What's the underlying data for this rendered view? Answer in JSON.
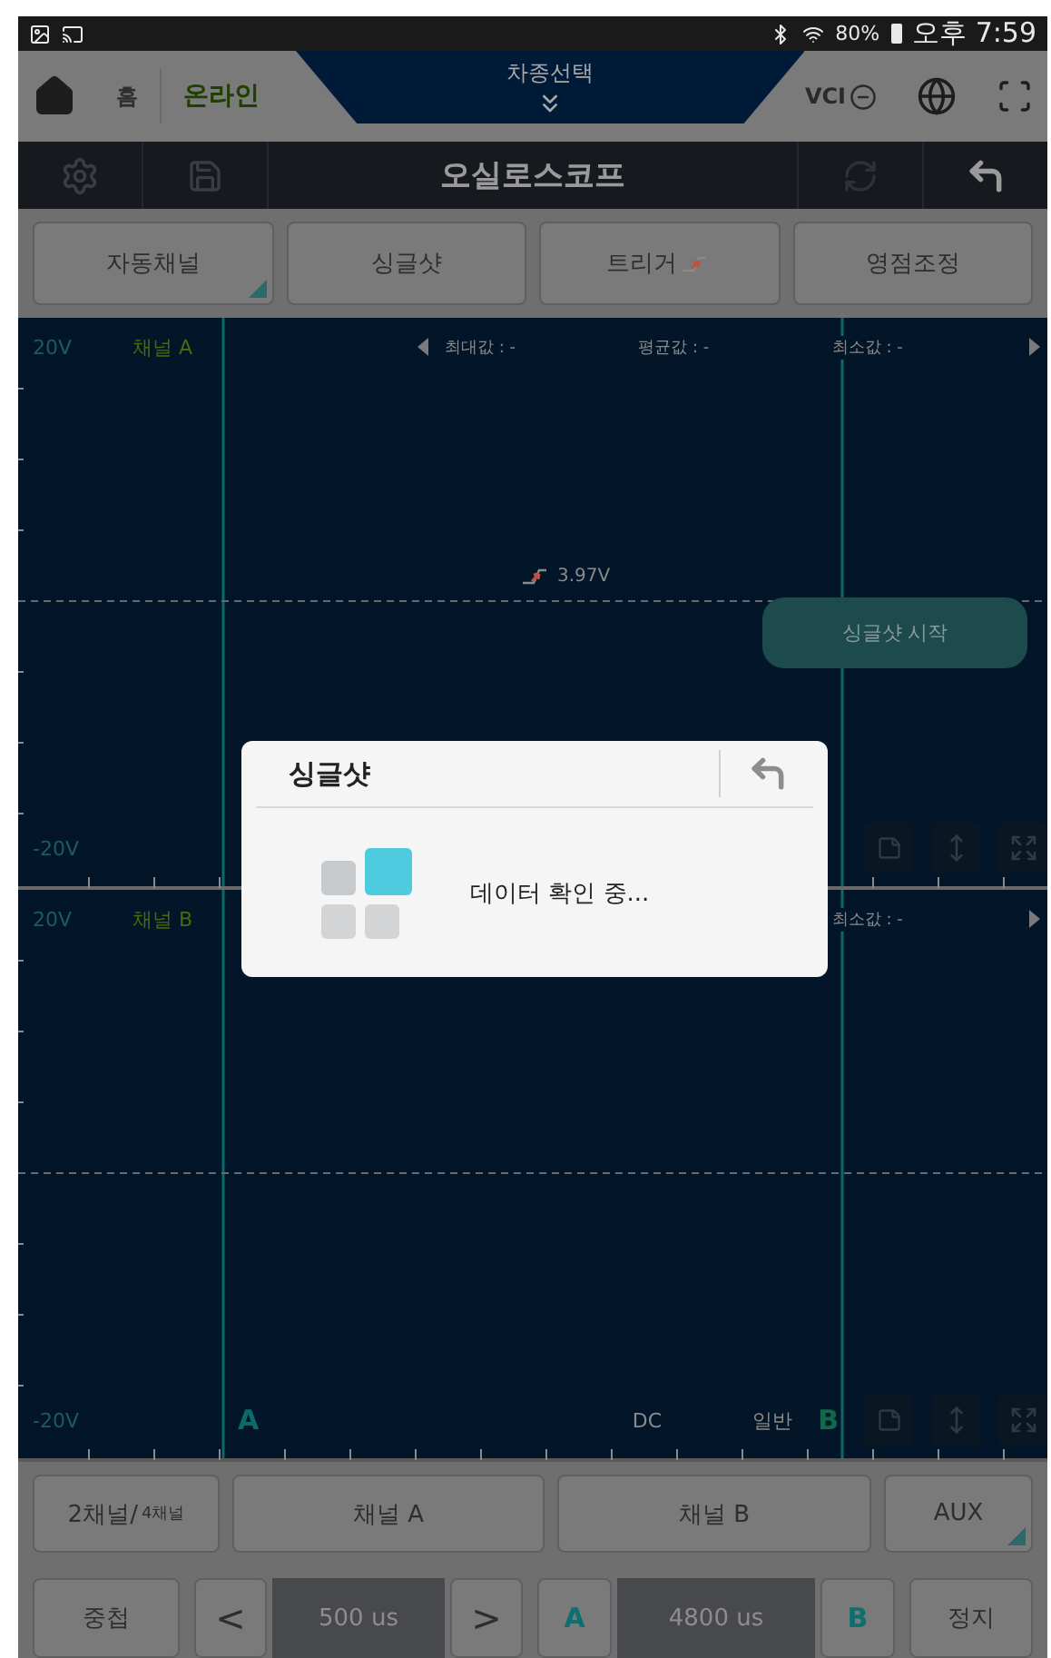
{
  "status_bar": {
    "battery": "80%",
    "time": "오후 7:59"
  },
  "header": {
    "home": "홈",
    "connection": "온라인",
    "vehicle_select": "차종선택",
    "vci": "VCI"
  },
  "toolbar": {
    "title": "오실로스코프"
  },
  "mode_buttons": [
    {
      "label": "자동채널",
      "kind": "menu"
    },
    {
      "label": "싱글샷",
      "kind": "plain"
    },
    {
      "label": "트리거",
      "kind": "trigger"
    },
    {
      "label": "영점조정",
      "kind": "plain"
    }
  ],
  "channels": [
    {
      "scale_top": "20V",
      "name": "채널 A",
      "stats": [
        "최대값 : -",
        "평균값 : -",
        "최소값 : -"
      ],
      "trigger_level": "3.97V",
      "action_button": "싱글샷 시작",
      "scale_bottom": "-20V"
    },
    {
      "scale_top": "20V",
      "name": "채널 B",
      "stats": [
        "최소값 : -"
      ],
      "scale_bottom": "-20V",
      "cursor_a": "A",
      "coupling": "DC",
      "mode": "일반",
      "cursor_b": "B"
    }
  ],
  "channel_buttons": [
    {
      "label": "2채널/",
      "sub": "4채널",
      "kind": "plain"
    },
    {
      "label": "채널 A",
      "kind": "plain"
    },
    {
      "label": "채널 B",
      "kind": "plain"
    },
    {
      "label": "AUX",
      "kind": "menu"
    }
  ],
  "timebase": {
    "overlay": "중첩",
    "prev": "<",
    "time_div": "500 us",
    "next": ">",
    "cursor_a": "A",
    "cursor_delta": "4800 us",
    "cursor_b": "B",
    "stop": "정지"
  },
  "dialog": {
    "title": "싱글샷",
    "message": "데이터 확인 중..."
  }
}
